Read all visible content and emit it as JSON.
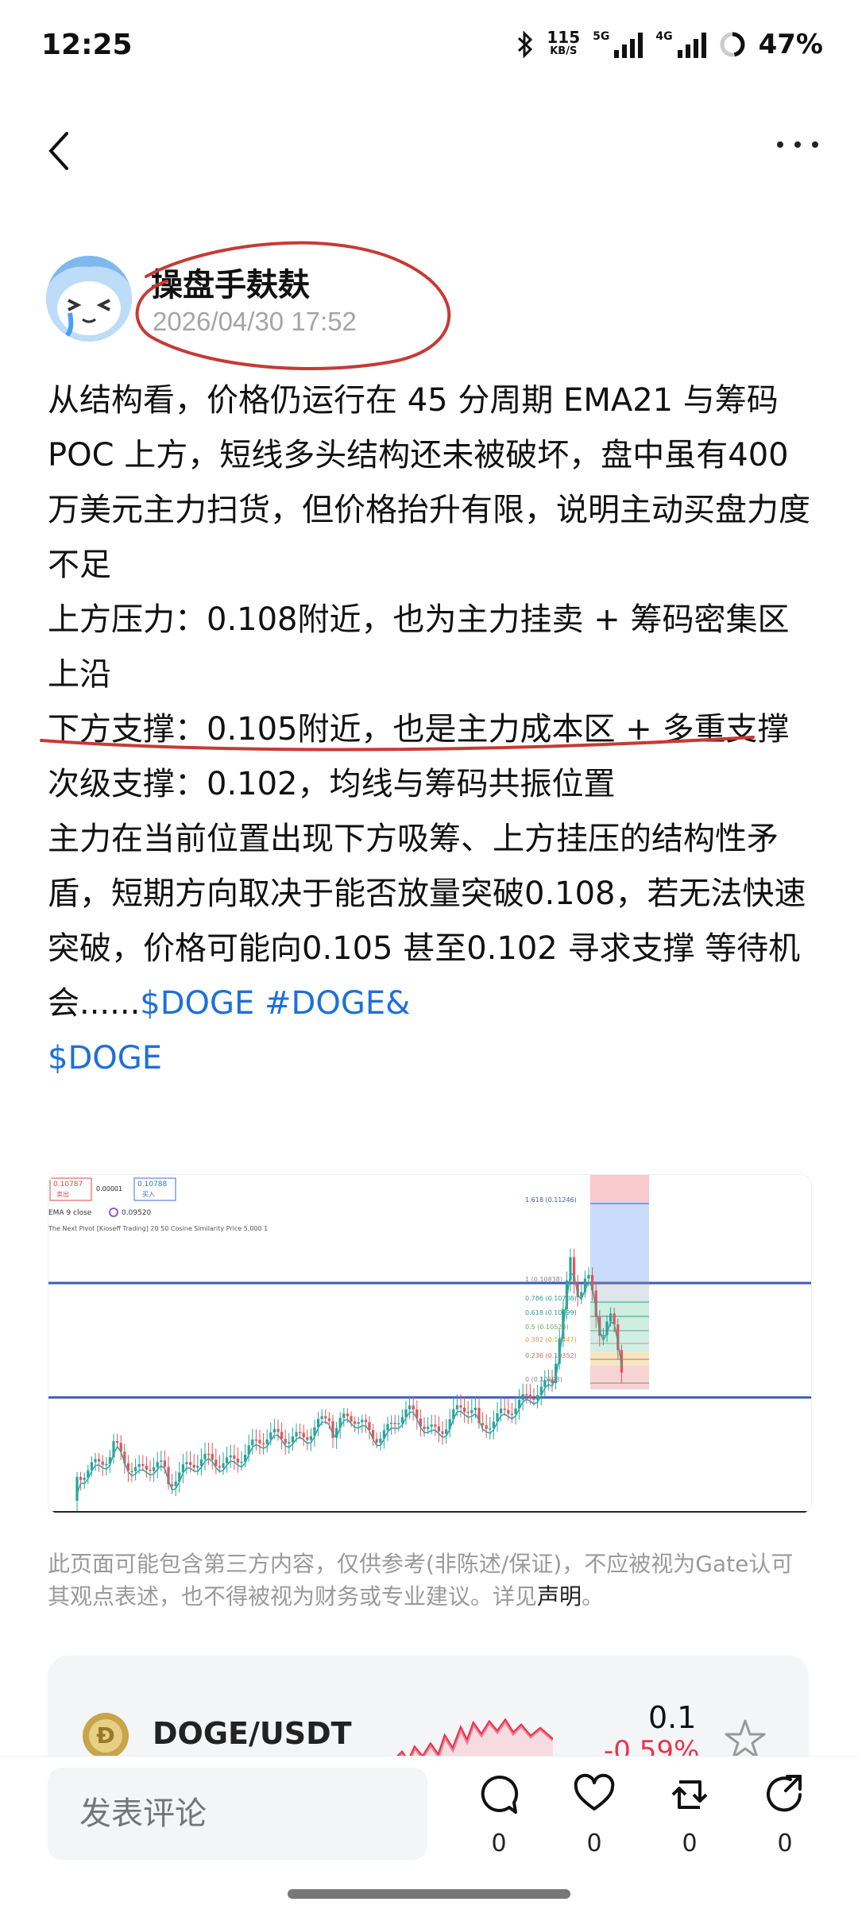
{
  "status_bar": {
    "time": "12:25",
    "net_speed": "115",
    "net_unit": "KB/S",
    "net_1": "5G",
    "net_2": "4G",
    "battery": "47%"
  },
  "post": {
    "author": "操盘手麸麸",
    "timestamp": "2026/04/30 17:52",
    "paragraphs": [
      "从结构看，价格仍运行在 45 分周期 EMA21 与筹码 POC 上方，短线多头结构还未被破坏，盘中虽有400 万美元主力扫货，但价格抬升有限，说明主动买盘力度不足",
      "上方压力：0.108附近，也为主力挂卖 + 筹码密集区上沿",
      "下方支撑：0.105附近，也是主力成本区 + 多重支撑",
      " 次级支撑：0.102，均线与筹码共振位置",
      "主力在当前位置出现下方吸筹、上方挂压的结构性矛盾，短期方向取决于能否放量突破0.108，若无法快速突破，价格可能向0.105 甚至0.102 寻求支撑   等待机会......"
    ],
    "tags": [
      "$DOGE",
      "#DOGE&",
      "$DOGE"
    ]
  },
  "chart": {
    "sell_price": "0.10787",
    "sell_label": "卖出",
    "spread": "0.00001",
    "buy_price": "0.10788",
    "buy_label": "买入",
    "ema_label": "EMA 9 close",
    "ema_value": "0.09520",
    "indicator": "The Next Pivot [Kioseff Trading] 20 50 Cosine Similarity Price 5,000 1",
    "fib_levels": [
      {
        "ratio": "1.618",
        "price": "0.11246"
      },
      {
        "ratio": "1",
        "price": "0.10838"
      },
      {
        "ratio": "0.786",
        "price": "0.10708"
      },
      {
        "ratio": "0.618",
        "price": "0.10599"
      },
      {
        "ratio": "0.5",
        "price": "0.10523"
      },
      {
        "ratio": "0.382",
        "price": "0.10447"
      },
      {
        "ratio": "0.236",
        "price": "0.10352"
      },
      {
        "ratio": "0",
        "price": "0.10198"
      }
    ]
  },
  "disclaimer": {
    "text": "此页面可能包含第三方内容，仅供参考(非陈述/保证)，不应被视为Gate认可其观点表述，也不得被视为财务或专业建议。详见",
    "link": "声明",
    "end": "。"
  },
  "market": {
    "pair": "DOGE/USDT",
    "price": "0.1",
    "change": "-0.59%",
    "up_color": "#e8344e"
  },
  "bottom": {
    "comment_placeholder": "发表评论",
    "comments": "0",
    "likes": "0",
    "reposts": "0",
    "shares": "0"
  }
}
